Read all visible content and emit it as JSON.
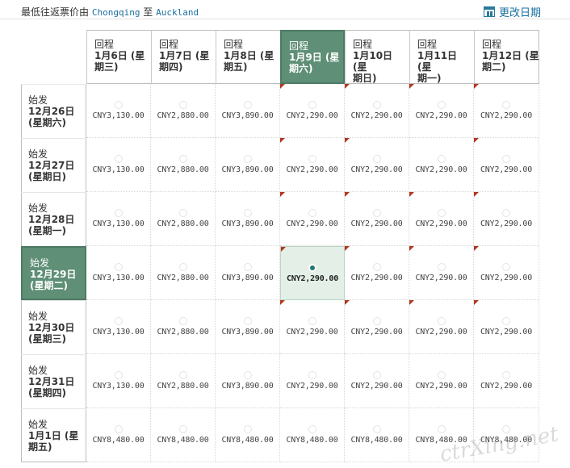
{
  "header": {
    "label": "最低往返票价由",
    "from_city": "Chongqing",
    "connector": "至",
    "to_city": "Auckland",
    "change_date": "更改日期"
  },
  "return_label": "回程",
  "depart_label": "始发",
  "return_dates": [
    {
      "date": "1月6日 (星",
      "weekday": "期三)"
    },
    {
      "date": "1月7日 (星",
      "weekday": "期四)"
    },
    {
      "date": "1月8日 (星",
      "weekday": "期五)"
    },
    {
      "date": "1月9日 (星",
      "weekday": "期六)"
    },
    {
      "date": "1月10日 (星",
      "weekday": "期日)"
    },
    {
      "date": "1月11日 (星",
      "weekday": "期一)"
    },
    {
      "date": "1月12日 (星",
      "weekday": "期二)"
    }
  ],
  "depart_dates": [
    {
      "date": "12月26日",
      "weekday": "(星期六)"
    },
    {
      "date": "12月27日",
      "weekday": "(星期日)"
    },
    {
      "date": "12月28日",
      "weekday": "(星期一)"
    },
    {
      "date": "12月29日",
      "weekday": "(星期二)"
    },
    {
      "date": "12月30日",
      "weekday": "(星期三)"
    },
    {
      "date": "12月31日",
      "weekday": "(星期四)"
    },
    {
      "date": "1月1日 (星",
      "weekday": "期五)"
    }
  ],
  "selected_return_index": 3,
  "selected_depart_index": 3,
  "prices": [
    [
      "CNY3,130.00",
      "CNY2,880.00",
      "CNY3,890.00",
      "CNY2,290.00",
      "CNY2,290.00",
      "CNY2,290.00",
      "CNY2,290.00"
    ],
    [
      "CNY3,130.00",
      "CNY2,880.00",
      "CNY3,890.00",
      "CNY2,290.00",
      "CNY2,290.00",
      "CNY2,290.00",
      "CNY2,290.00"
    ],
    [
      "CNY3,130.00",
      "CNY2,880.00",
      "CNY3,890.00",
      "CNY2,290.00",
      "CNY2,290.00",
      "CNY2,290.00",
      "CNY2,290.00"
    ],
    [
      "CNY3,130.00",
      "CNY2,880.00",
      "CNY3,890.00",
      "CNY2,290.00",
      "CNY2,290.00",
      "CNY2,290.00",
      "CNY2,290.00"
    ],
    [
      "CNY3,130.00",
      "CNY2,880.00",
      "CNY3,890.00",
      "CNY2,290.00",
      "CNY2,290.00",
      "CNY2,290.00",
      "CNY2,290.00"
    ],
    [
      "CNY3,130.00",
      "CNY2,880.00",
      "CNY3,890.00",
      "CNY2,290.00",
      "CNY2,290.00",
      "CNY2,290.00",
      "CNY2,290.00"
    ],
    [
      "CNY8,480.00",
      "CNY8,480.00",
      "CNY8,480.00",
      "CNY8,480.00",
      "CNY8,480.00",
      "CNY8,480.00",
      "CNY8,480.00"
    ]
  ],
  "lowest_fare_flags": [
    [
      false,
      false,
      false,
      true,
      true,
      true,
      true
    ],
    [
      false,
      false,
      false,
      true,
      true,
      false,
      true
    ],
    [
      false,
      false,
      false,
      true,
      true,
      true,
      true
    ],
    [
      false,
      false,
      false,
      true,
      true,
      true,
      true
    ],
    [
      false,
      false,
      false,
      true,
      true,
      true,
      true
    ],
    [
      false,
      false,
      false,
      false,
      false,
      false,
      false
    ],
    [
      false,
      false,
      false,
      false,
      false,
      false,
      false
    ]
  ],
  "colors": {
    "selected": "#5f8f76",
    "selected_cell": "#e4efe8",
    "flag": "#b3341f",
    "link": "#1a6fa0"
  },
  "icons": {
    "change_date": "calendar-icon"
  },
  "watermark": "ctrXing.net"
}
